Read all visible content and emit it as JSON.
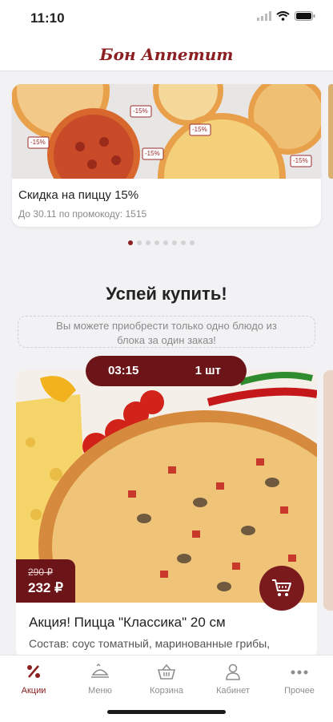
{
  "status_bar": {
    "time": "11:10"
  },
  "header": {
    "logo_text": "Бон Аппетит"
  },
  "promo": {
    "title": "Скидка на пиццу 15%",
    "subtitle": "До 30.11 по промокоду: 1515",
    "tags": [
      "-15%",
      "-15%",
      "-15%",
      "-15%",
      "-15%"
    ],
    "dots_count": 8,
    "active_dot": 0
  },
  "section": {
    "title": "Успей купить!",
    "notice": "Вы можете приобрести только одно блюдо из блока за один заказ!"
  },
  "product": {
    "timer": "03:15",
    "quantity": "1 шт",
    "old_price": "290 ₽",
    "price": "232 ₽",
    "title": "Акция! Пицца \"Классика\" 20 см",
    "description": "Состав: соус томатный, маринованные грибы,"
  },
  "tabbar": {
    "items": [
      {
        "label": "Акции",
        "icon": "percent-icon",
        "active": true
      },
      {
        "label": "Меню",
        "icon": "menu-dish-icon",
        "active": false
      },
      {
        "label": "Корзина",
        "icon": "basket-icon",
        "active": false
      },
      {
        "label": "Кабинет",
        "icon": "user-icon",
        "active": false
      },
      {
        "label": "Прочее",
        "icon": "more-icon",
        "active": false
      }
    ]
  },
  "colors": {
    "accent": "#8b1f22",
    "accent_dark": "#6c1518"
  }
}
